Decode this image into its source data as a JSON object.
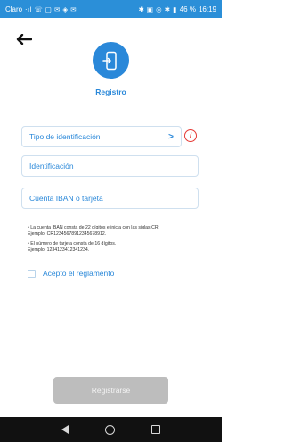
{
  "status_bar": {
    "carrier": "Claro",
    "left_glyphs": "⋅ıl ☏ ▢ ✉ ◈ ✉",
    "right_glyphs": "✱ ▣ ◎ ✱ ▮",
    "battery": "46 %",
    "time": "16:19"
  },
  "header": {
    "back_icon": "arrow-left-icon",
    "logo_icon": "phone-login-icon",
    "title": "Registro"
  },
  "form": {
    "id_type_label": "Tipo de identificación",
    "id_type_chevron": ">",
    "info_glyph": "i",
    "identification_label": "Identificación",
    "iban_label": "Cuenta IBAN o tarjeta",
    "note_iban_line1": "• La cuenta IBAN consta de 22 dígitos e inicia con las siglas CR.",
    "note_iban_line2": "Ejemplo: CR12345678912345678912.",
    "note_card_line1": "• El número de tarjeta consta de 16 dígitos.",
    "note_card_line2": "Ejemplo: 1234123412341234.",
    "terms_label": "Acepto el reglamento",
    "terms_checked": false
  },
  "actions": {
    "register_label": "Registrarse"
  },
  "colors": {
    "accent": "#2a88d9",
    "status_bar": "#2b8fd8",
    "error": "#e53935",
    "disabled_button": "#bdbdbd",
    "nav_bar": "#111111"
  }
}
